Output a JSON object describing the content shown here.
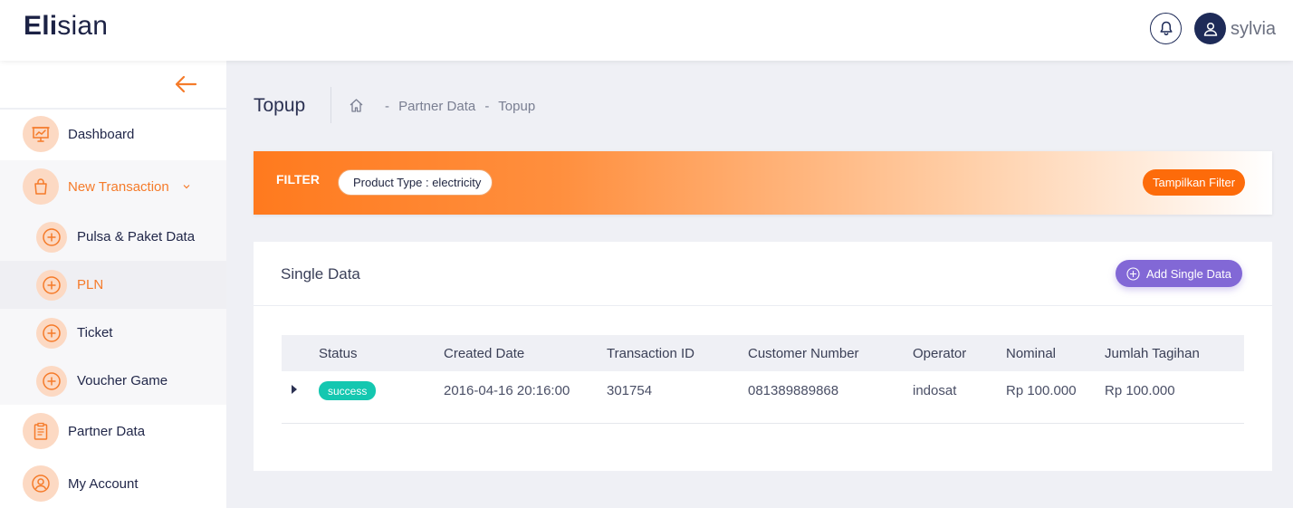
{
  "header": {
    "logo_bold": "Eli",
    "logo_rest": "sian",
    "username": "sylvia"
  },
  "sidebar": {
    "items": [
      {
        "label": "Dashboard",
        "icon": "presentation-chart-icon"
      },
      {
        "label": "New Transaction",
        "icon": "bag-icon",
        "expanded": true
      },
      {
        "label": "Partner Data",
        "icon": "clipboard-icon"
      },
      {
        "label": "My Account",
        "icon": "user-circle-icon"
      }
    ],
    "sub_items": [
      {
        "label": "Pulsa & Paket Data"
      },
      {
        "label": "PLN",
        "active": true
      },
      {
        "label": "Ticket"
      },
      {
        "label": "Voucher Game"
      }
    ]
  },
  "page": {
    "title": "Topup",
    "breadcrumb": [
      "-",
      "Partner Data",
      "-",
      "Topup"
    ]
  },
  "filter": {
    "label": "FILTER",
    "chip": "Product Type : electricity",
    "show_button": "Tampilkan Filter"
  },
  "card": {
    "title": "Single Data",
    "add_button": "Add Single Data",
    "columns": [
      "Status",
      "Created Date",
      "Transaction ID",
      "Customer Number",
      "Operator",
      "Nominal",
      "Jumlah Tagihan"
    ],
    "rows": [
      {
        "status": "success",
        "created_date": "2016-04-16 20:16:00",
        "transaction_id": "301754",
        "customer_number": "081389889868",
        "operator": "indosat",
        "nominal": "Rp 100.000",
        "jumlah_tagihan": "Rp 100.000"
      }
    ]
  },
  "colors": {
    "accent_orange": "#fd6b0a",
    "accent_purple": "#8268d6",
    "success": "#14c7b0",
    "navy": "#1e2b58"
  }
}
